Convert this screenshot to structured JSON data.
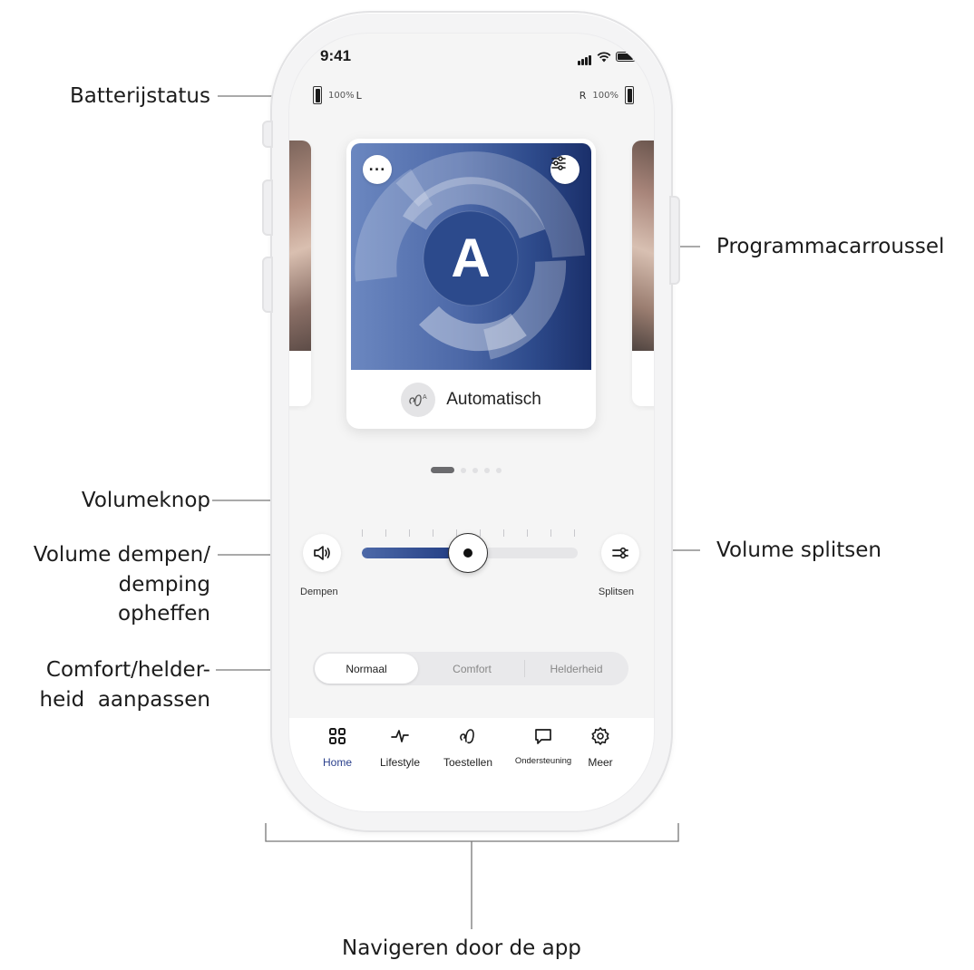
{
  "annotations": {
    "battery_status": "Batterijstatus",
    "program_carousel": "Programmacarroussel",
    "volume_knob": "Volumeknop",
    "mute_line1": "Volume dempen/",
    "mute_line2": "demping",
    "mute_line3": "opheffen",
    "split_volume": "Volume splitsen",
    "comfort_line1": "Comfort/helder-",
    "comfort_line2": "heid  aanpassen",
    "navigate": "Navigeren door de app"
  },
  "status_bar": {
    "time": "9:41",
    "icons": [
      "cellular-signal-icon",
      "wifi-icon",
      "battery-icon"
    ]
  },
  "battery": {
    "left_percent": "100%",
    "left_side": "L",
    "right_side": "R",
    "right_percent": "100%"
  },
  "carousel": {
    "active_program": "Automatisch",
    "program_letter": "A",
    "program_icon": "hearing-aid-auto-icon",
    "more_glyph": "...",
    "page_count": 5,
    "active_page": 0
  },
  "volume": {
    "mute_label": "Dempen",
    "split_label": "Splitsen",
    "level_percent": 49
  },
  "sound_mode": {
    "options": [
      "Normaal",
      "Comfort",
      "Helderheid"
    ],
    "selected": "Normaal"
  },
  "tabbar": {
    "items": [
      {
        "label": "Home",
        "icon": "grid-icon",
        "active": true
      },
      {
        "label": "Lifestyle",
        "icon": "activity-pulse-icon",
        "active": false
      },
      {
        "label": "Toestellen",
        "icon": "hearing-aid-icon",
        "active": false
      },
      {
        "label": "Ondersteuning",
        "icon": "chat-bubble-icon",
        "active": false
      },
      {
        "label": "Meer",
        "icon": "gear-icon",
        "active": false
      }
    ]
  },
  "colors": {
    "accent_blue": "#2a3f8c",
    "card_gradient_start": "#6b87c0",
    "card_gradient_end": "#1a2f6a"
  }
}
